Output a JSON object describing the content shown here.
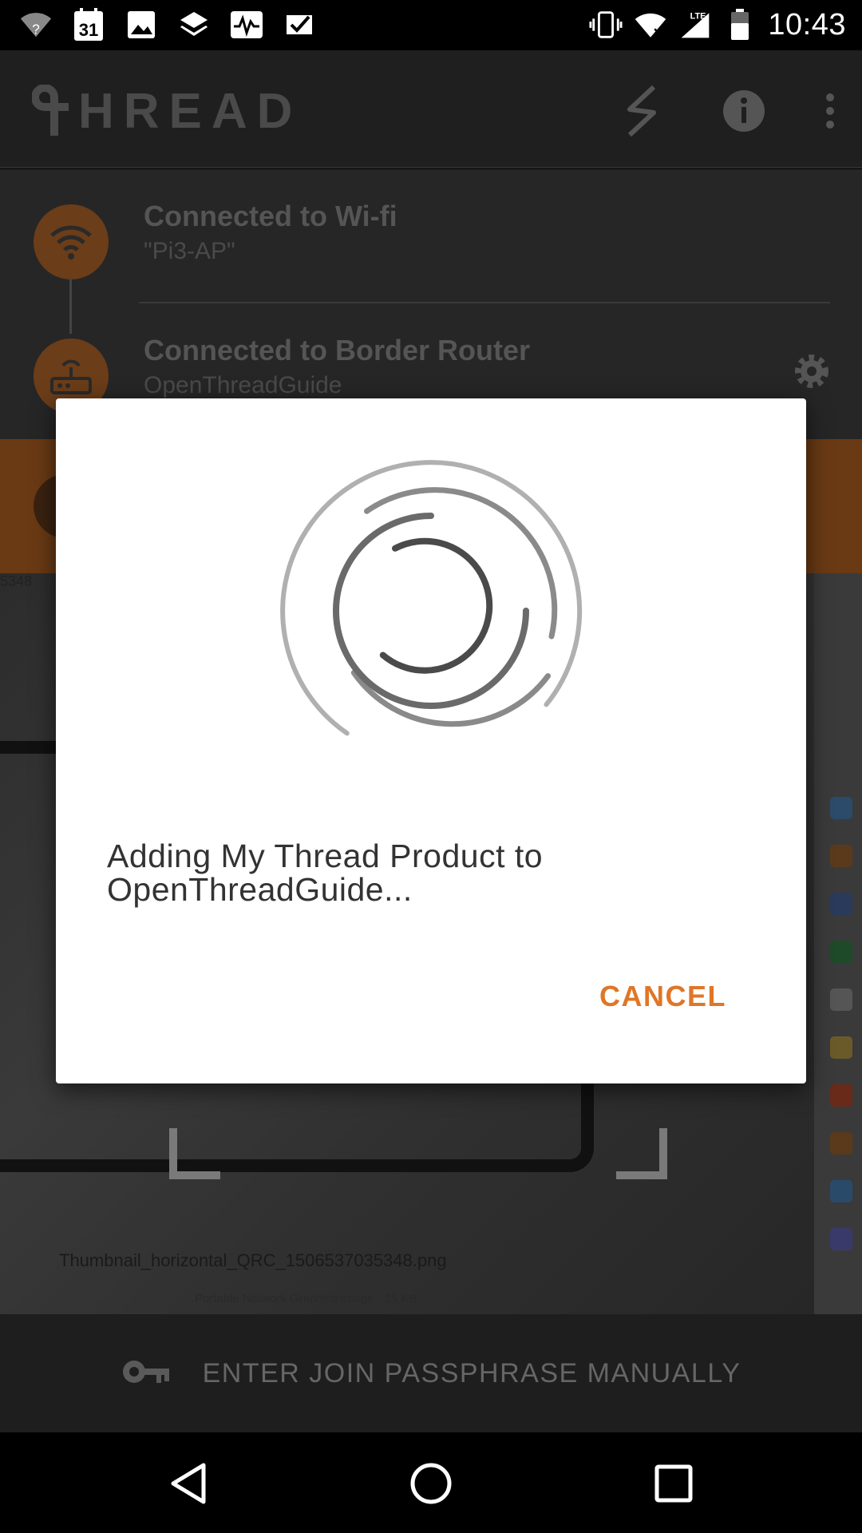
{
  "status_bar": {
    "time": "10:43",
    "calendar_day": "31",
    "network": "LTE",
    "icons_left": [
      "wifi-unknown-icon",
      "calendar-icon",
      "image-icon",
      "layers-icon",
      "activity-icon",
      "check-icon"
    ],
    "icons_right": [
      "vibrate-icon",
      "wifi-icon",
      "signal-icon",
      "battery-icon"
    ]
  },
  "app_bar": {
    "logo_text": "HREAD",
    "actions": [
      "flash-icon",
      "info-icon",
      "more-vert-icon"
    ]
  },
  "connections": [
    {
      "title": "Connected to Wi-fi",
      "subtitle": "\"Pi3-AP\"",
      "icon": "wifi-icon"
    },
    {
      "title": "Connected to Border Router",
      "subtitle": "OpenThreadGuide",
      "icon": "router-icon"
    }
  ],
  "camera_preview": {
    "filename": "Thumbnail_horizontal_QRC_1506537035348.png",
    "file_info": "Portable Network Graphics image - 15 KB",
    "top_fragment": "5348"
  },
  "bottom_action": {
    "label": "ENTER JOIN PASSPHRASE MANUALLY",
    "icon": "key-icon"
  },
  "dialog": {
    "message": "Adding My Thread Product to OpenThreadGuide...",
    "cancel_label": "CANCEL"
  },
  "navigation": [
    "back-icon",
    "home-icon",
    "recents-icon"
  ],
  "colors": {
    "accent": "#e07628",
    "dialog_bg": "#ffffff",
    "dialog_text": "#333333",
    "scrim_orange": "#6a3a14"
  }
}
